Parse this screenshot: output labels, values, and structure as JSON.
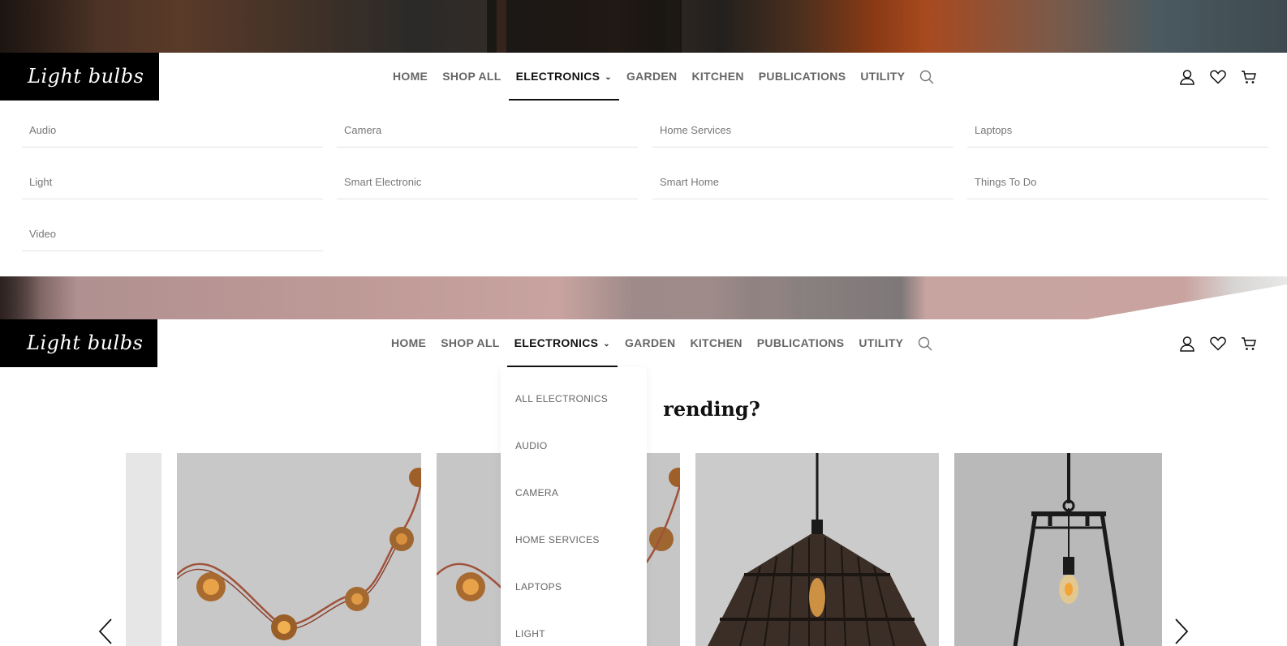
{
  "brand": {
    "logo_text": "Light bulbs"
  },
  "nav": {
    "items": [
      "HOME",
      "SHOP ALL",
      "ELECTRONICS",
      "GARDEN",
      "KITCHEN",
      "PUBLICATIONS",
      "UTILITY"
    ],
    "active": "ELECTRONICS"
  },
  "mega_menu": {
    "items": [
      "Audio",
      "Camera",
      "Home Services",
      "Laptops",
      "Light",
      "Smart Electronic",
      "Smart Home",
      "Things To Do",
      "Video"
    ]
  },
  "dropdown": {
    "items": [
      "ALL ELECTRONICS",
      "AUDIO",
      "CAMERA",
      "HOME SERVICES",
      "LAPTOPS",
      "LIGHT"
    ]
  },
  "section": {
    "title_visible": "rending?"
  },
  "icons": {
    "search": "search-icon",
    "account": "user-icon",
    "wishlist": "heart-icon",
    "cart": "cart-icon",
    "chevron": "chevron-down-icon",
    "prev": "chevron-left-icon",
    "next": "chevron-right-icon"
  },
  "colors": {
    "logo_bg": "#000000",
    "active_nav": "#111111",
    "nav_text": "#666666"
  }
}
